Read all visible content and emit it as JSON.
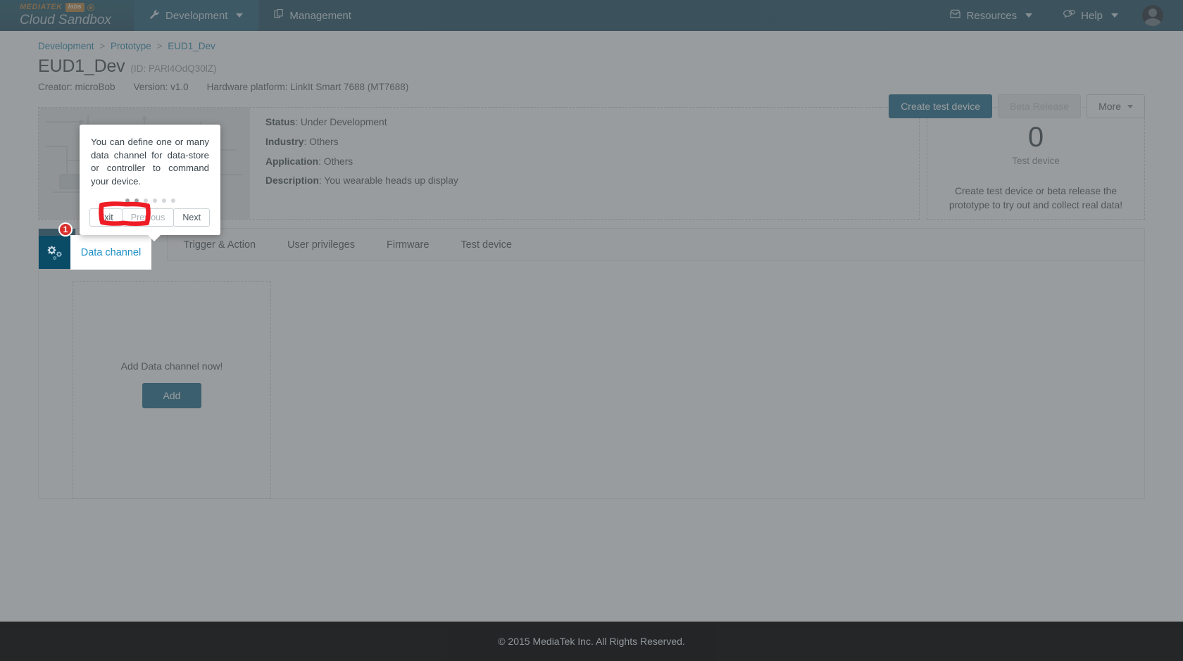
{
  "topbar": {
    "brand": {
      "mediatek": "MEDIATEK",
      "labs": "labs",
      "product": "Cloud Sandbox"
    },
    "nav": [
      {
        "label": "Development",
        "icon": "wrench-icon",
        "active": true,
        "caret": true
      },
      {
        "label": "Management",
        "icon": "documents-icon",
        "active": false,
        "caret": false
      }
    ],
    "right_nav": [
      {
        "label": "Resources",
        "icon": "inbox-icon",
        "caret": true
      },
      {
        "label": "Help",
        "icon": "chat-icon",
        "caret": true
      }
    ],
    "avatar_caret": true
  },
  "breadcrumb": {
    "items": [
      "Development",
      "Prototype",
      "EUD1_Dev"
    ],
    "separator": ">"
  },
  "header": {
    "title": "EUD1_Dev",
    "id_text": "(ID: PARl4OdQ30lZ)",
    "meta": [
      {
        "label": "Creator:",
        "value": "microBob"
      },
      {
        "label": "Version:",
        "value": "v1.0"
      },
      {
        "label": "Hardware platform:",
        "value": "LinkIt Smart 7688 (MT7688)"
      }
    ],
    "actions": [
      {
        "label": "Create test device",
        "style": "primary"
      },
      {
        "label": "Beta Release",
        "style": "disabled"
      },
      {
        "label": "More",
        "style": "default",
        "caret": true
      }
    ]
  },
  "info": {
    "fields": [
      {
        "label": "Status",
        "value": "Under Development"
      },
      {
        "label": "Industry",
        "value": "Others"
      },
      {
        "label": "Application",
        "value": "Others"
      },
      {
        "label": "Description",
        "value": "You wearable heads up display"
      }
    ],
    "test_device": {
      "count": "0",
      "label": "Test device",
      "hint": "Create test device or beta release the prototype to try out and collect real data!"
    }
  },
  "tabs": {
    "icon": "gears-icon",
    "items": [
      {
        "label": "Data channel",
        "active": true
      },
      {
        "label": "Trigger & Action",
        "active": false
      },
      {
        "label": "User privileges",
        "active": false
      },
      {
        "label": "Firmware",
        "active": false
      },
      {
        "label": "Test device",
        "active": false
      }
    ]
  },
  "empty_state": {
    "text": "Add Data channel now!",
    "button": "Add"
  },
  "tour": {
    "text": "You can define one or many data channel for data-store or controller to command your device.",
    "dots_total": 6,
    "dots_active_index": 1,
    "buttons": {
      "exit": "Exit",
      "previous": "Previous",
      "next": "Next"
    },
    "step_badge": "1"
  },
  "footer": {
    "text": "© 2015 MediaTek Inc. All Rights Reserved."
  },
  "colors": {
    "brand_dark": "#0a4b66",
    "primary": "#0a6081",
    "link": "#1a7fa8",
    "tab_active": "#1a8ec4",
    "accent_orange": "#b4762a",
    "badge_red": "#d9302c",
    "footer_bg": "#1c1c1c"
  }
}
